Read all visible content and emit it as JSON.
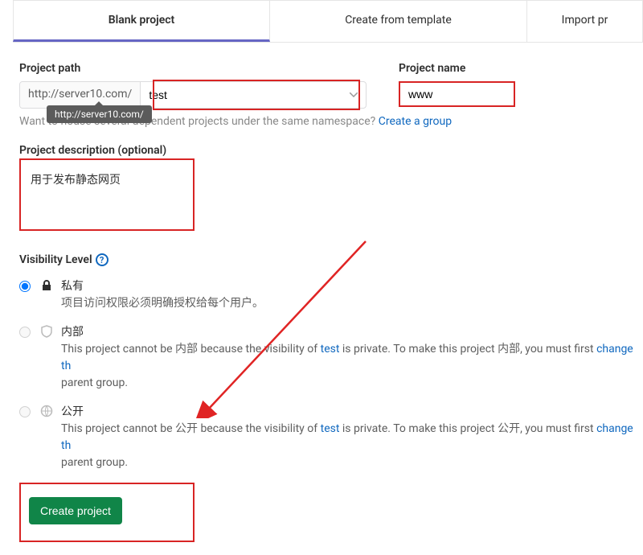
{
  "tabs": {
    "blank": "Blank project",
    "template": "Create from template",
    "import": "Import pr"
  },
  "form": {
    "path_label": "Project path",
    "name_label": "Project name",
    "path_prefix": "http://server10.com/",
    "namespace_value": "test",
    "name_value": "www",
    "tooltip": "http://server10.com/",
    "hint_text": "Want to house several dependent projects under the same namespace? ",
    "hint_link": "Create a group",
    "desc_label": "Project description (optional)",
    "desc_value": "用于发布静态网页"
  },
  "visibility": {
    "label": "Visibility Level",
    "options": [
      {
        "title": "私有",
        "desc_pre": "项目访问权限必须明确授权给每个用户。",
        "desc_mid_link": "",
        "desc_post": ""
      },
      {
        "title": "内部",
        "desc_pre": "This project cannot be 内部 because the visibility of ",
        "desc_mid_link": "test",
        "desc_post": " is private. To make this project 内部, you must first ",
        "desc_tail_link": "change th",
        "desc_tail": " parent group."
      },
      {
        "title": "公开",
        "desc_pre": "This project cannot be 公开 because the visibility of ",
        "desc_mid_link": "test",
        "desc_post": " is private. To make this project 公开, you must first ",
        "desc_tail_link": "change th",
        "desc_tail": " parent group."
      }
    ]
  },
  "button": {
    "create": "Create project"
  }
}
